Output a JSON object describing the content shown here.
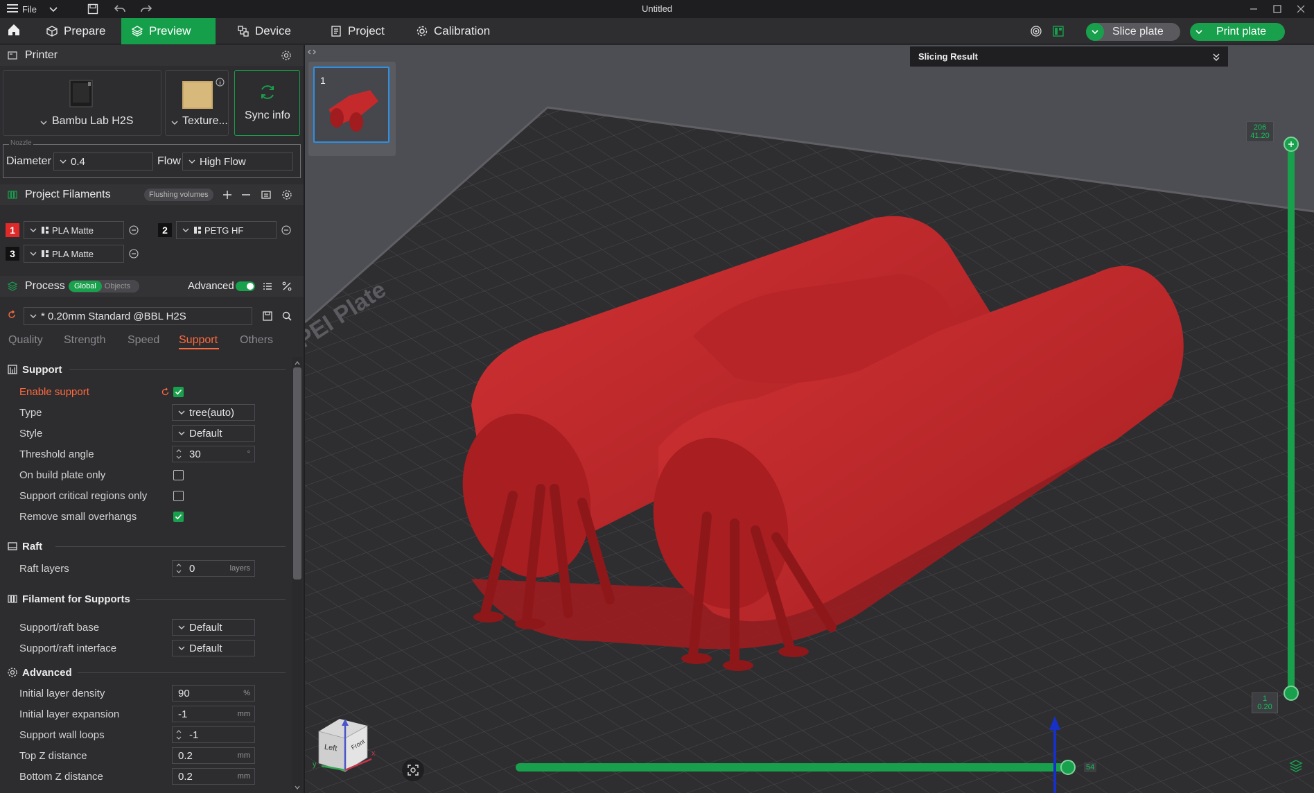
{
  "window": {
    "menu_label": "File",
    "title": "Untitled"
  },
  "nav": {
    "tabs": [
      {
        "label": "Prepare"
      },
      {
        "label": "Preview"
      },
      {
        "label": "Device"
      },
      {
        "label": "Project"
      },
      {
        "label": "Calibration"
      }
    ],
    "active_tab": "Preview",
    "slice_button": "Slice plate",
    "print_button": "Print plate"
  },
  "printer": {
    "header": "Printer",
    "model": "Bambu Lab H2S",
    "plate": "Texture...",
    "sync_label": "Sync info",
    "nozzle_legend": "Nozzle",
    "diameter_label": "Diameter",
    "diameter_value": "0.4",
    "flow_label": "Flow",
    "flow_value": "High Flow"
  },
  "filaments": {
    "header": "Project Filaments",
    "flushing_label": "Flushing volumes",
    "items": [
      {
        "num": "1",
        "name": "PLA Matte",
        "color": "#e02a2a"
      },
      {
        "num": "2",
        "name": "PETG HF",
        "color": "#111111"
      },
      {
        "num": "3",
        "name": "PLA Matte",
        "color": "#111111"
      }
    ]
  },
  "process": {
    "header": "Process",
    "global_label": "Global",
    "objects_label": "Objects",
    "advanced_label": "Advanced",
    "advanced_on": true,
    "profile": "* 0.20mm Standard @BBL H2S",
    "tabs": [
      "Quality",
      "Strength",
      "Speed",
      "Support",
      "Others"
    ],
    "active_tab": "Support"
  },
  "support": {
    "title": "Support",
    "enable_label": "Enable support",
    "enable_checked": true,
    "type_label": "Type",
    "type_value": "tree(auto)",
    "style_label": "Style",
    "style_value": "Default",
    "threshold_label": "Threshold angle",
    "threshold_value": "30",
    "threshold_unit": "°",
    "build_plate_label": "On build plate only",
    "build_plate_checked": false,
    "critical_label": "Support critical regions only",
    "critical_checked": false,
    "small_overhangs_label": "Remove small overhangs",
    "small_overhangs_checked": true
  },
  "raft": {
    "title": "Raft",
    "layers_label": "Raft layers",
    "layers_value": "0",
    "layers_unit": "layers"
  },
  "filament_supports": {
    "title": "Filament for Supports",
    "base_label": "Support/raft base",
    "base_value": "Default",
    "interface_label": "Support/raft interface",
    "interface_value": "Default"
  },
  "advanced": {
    "title": "Advanced",
    "density_label": "Initial layer density",
    "density_value": "90",
    "density_unit": "%",
    "expansion_label": "Initial layer expansion",
    "expansion_value": "-1",
    "expansion_unit": "mm",
    "wall_loops_label": "Support wall loops",
    "wall_loops_value": "-1",
    "top_z_label": "Top Z distance",
    "top_z_value": "0.2",
    "top_z_unit": "mm",
    "bottom_z_label": "Bottom Z distance",
    "bottom_z_value": "0.2",
    "bottom_z_unit": "mm"
  },
  "viewport": {
    "plate_number": "1",
    "plate_text": "PEI Plate",
    "slicing_result_label": "Slicing Result",
    "layer_top_value": "206",
    "layer_top_height": "41.20",
    "layer_bottom_value": "1",
    "layer_bottom_height": "0.20",
    "move_value": "54",
    "cube_left": "Left",
    "cube_front": "Front",
    "axis_y": "y",
    "axis_x": "x",
    "model_color": "#c42a2c"
  }
}
